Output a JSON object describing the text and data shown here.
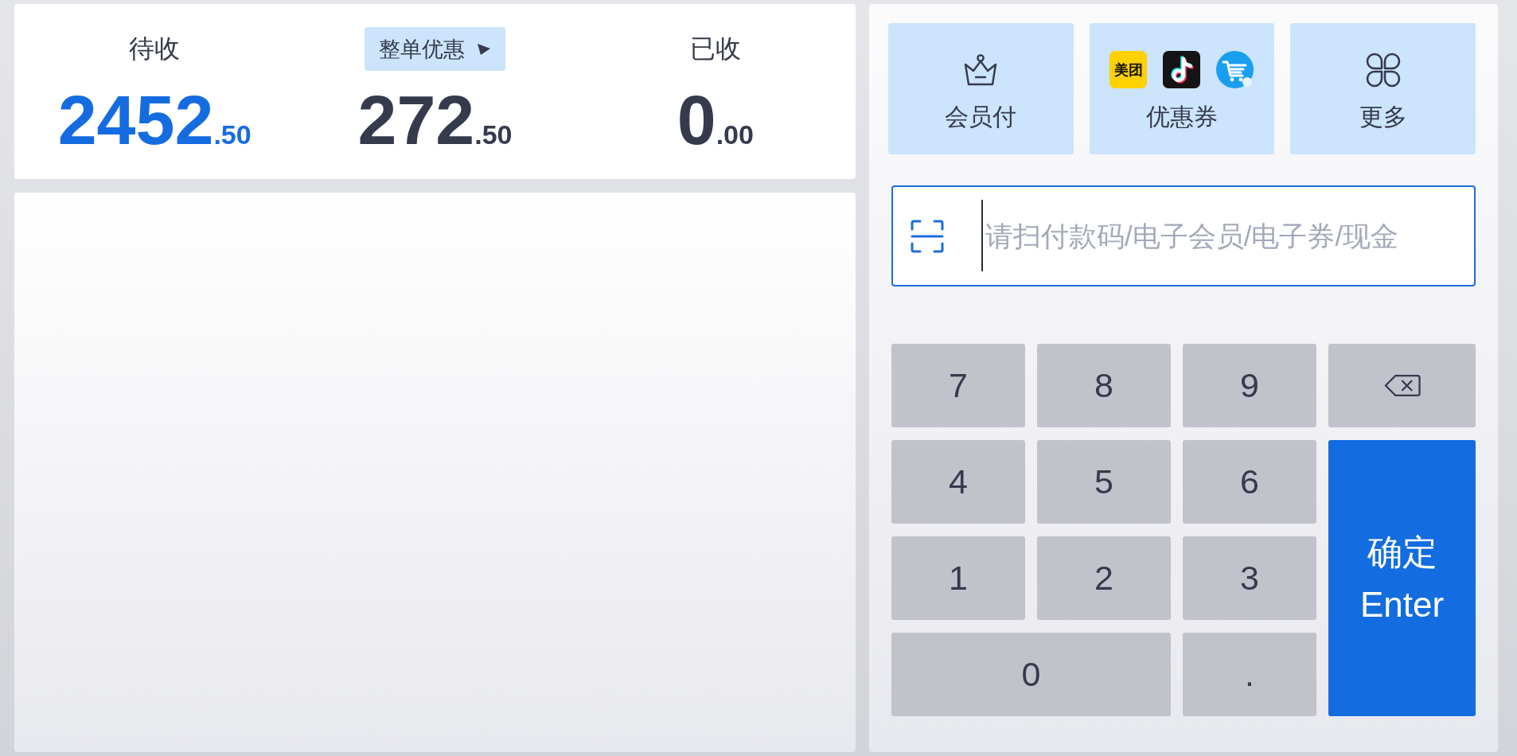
{
  "summary": {
    "columns": [
      {
        "kind": "label",
        "label": "待收",
        "integer": "2452",
        "decimal": ".50",
        "highlighted": true
      },
      {
        "kind": "button",
        "label": "整单优惠",
        "integer": "272",
        "decimal": ".50",
        "highlighted": false
      },
      {
        "kind": "label",
        "label": "已收",
        "integer": "0",
        "decimal": ".00",
        "highlighted": false
      }
    ]
  },
  "payment_methods": [
    {
      "kind": "member",
      "label": "会员付"
    },
    {
      "kind": "coupon",
      "label": "优惠券",
      "logos": [
        {
          "kind": "text_logo",
          "text": "美团"
        },
        {
          "kind": "music_note"
        },
        {
          "kind": "cart"
        }
      ]
    },
    {
      "kind": "more",
      "label": "更多"
    }
  ],
  "scan_input": {
    "placeholder": "请扫付款码/电子会员/电子券/现金",
    "focused": true
  },
  "keypad": {
    "keys": [
      {
        "kind": "key",
        "label": "7"
      },
      {
        "kind": "key",
        "label": "8"
      },
      {
        "kind": "key",
        "label": "9"
      },
      {
        "kind": "backspace"
      },
      {
        "kind": "key",
        "label": "4"
      },
      {
        "kind": "key",
        "label": "5"
      },
      {
        "kind": "key",
        "label": "6"
      },
      {
        "kind": "key",
        "label": "1"
      },
      {
        "kind": "key",
        "label": "2"
      },
      {
        "kind": "key",
        "label": "3"
      },
      {
        "kind": "enter",
        "label": "确定",
        "sublabel": "Enter"
      },
      {
        "kind": "wide_key",
        "label": "0"
      },
      {
        "kind": "key",
        "label": "."
      }
    ]
  }
}
